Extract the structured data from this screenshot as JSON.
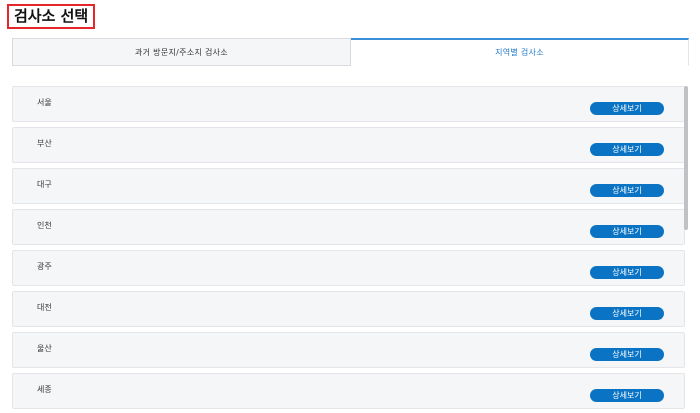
{
  "header": {
    "title": "검사소 선택"
  },
  "tabs": [
    {
      "label": "과거 방문지/주소지 검사소",
      "active": false
    },
    {
      "label": "지역별 검사소",
      "active": true
    }
  ],
  "regions": [
    {
      "name": "서울",
      "button": "상세보기"
    },
    {
      "name": "부산",
      "button": "상세보기"
    },
    {
      "name": "대구",
      "button": "상세보기"
    },
    {
      "name": "인천",
      "button": "상세보기"
    },
    {
      "name": "광주",
      "button": "상세보기"
    },
    {
      "name": "대전",
      "button": "상세보기"
    },
    {
      "name": "울산",
      "button": "상세보기"
    },
    {
      "name": "세종",
      "button": "상세보기"
    }
  ],
  "colors": {
    "accent": "#0a73c4",
    "title_outline": "#e5262a",
    "active_tab_text": "#1f78c8"
  }
}
